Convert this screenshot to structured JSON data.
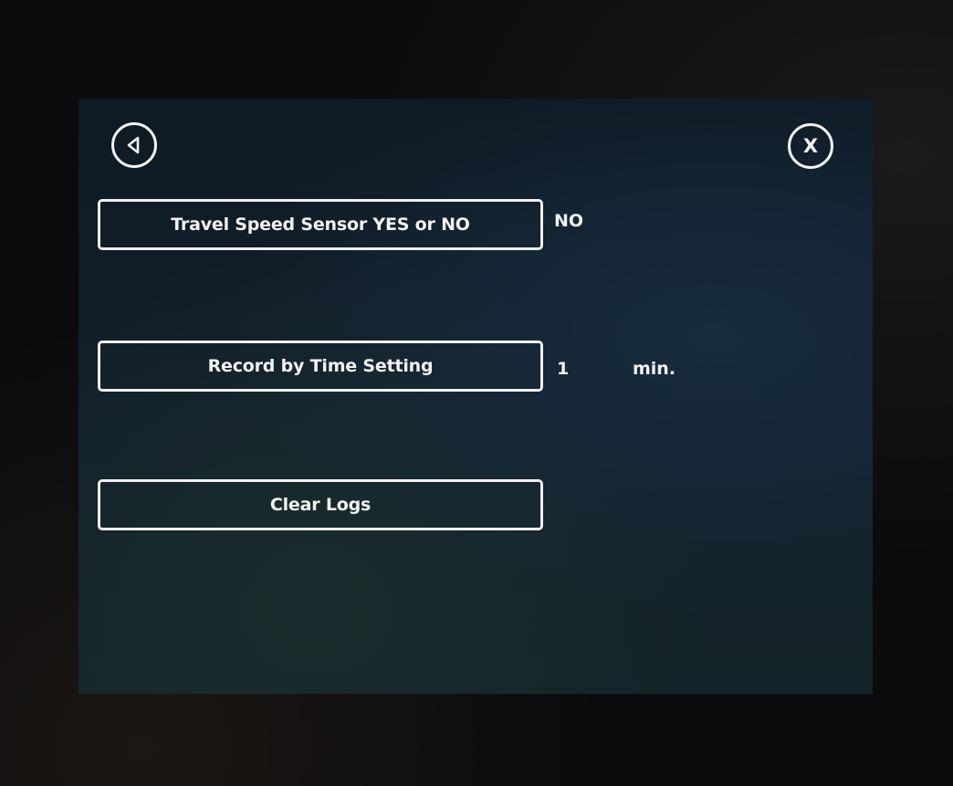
{
  "icons": {
    "back": "back-triangle-icon",
    "close": "close-x-icon"
  },
  "close_glyph": "X",
  "buttons": {
    "travel_speed_sensor": "Travel Speed Sensor YES or NO",
    "record_by_time": "Record by Time Setting",
    "clear_logs": "Clear Logs"
  },
  "values": {
    "travel_speed_sensor": "NO",
    "record_by_time": "1",
    "record_by_time_unit": "min."
  },
  "colors": {
    "foreground": "#f2f2f2",
    "screen_background": "#0e1a24"
  }
}
